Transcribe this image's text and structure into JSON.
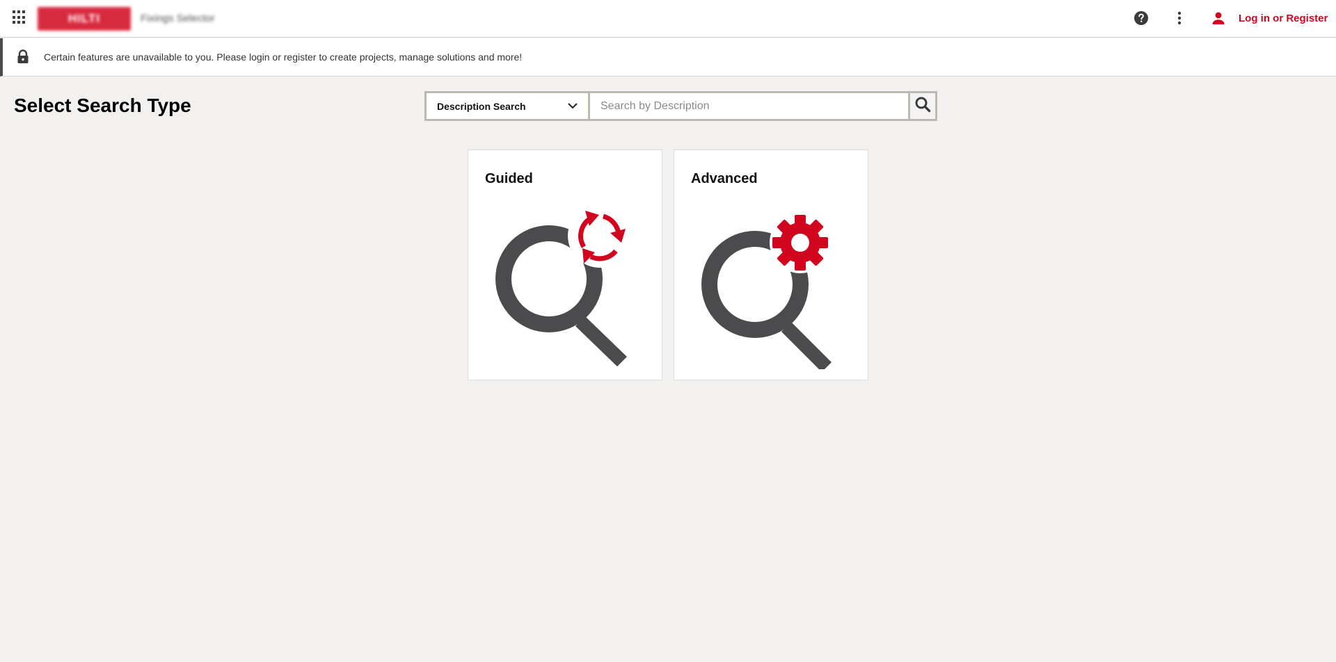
{
  "header": {
    "apps_icon": "apps-grid-icon",
    "brand_logo_text": "HILTI",
    "app_name": "Fixings Selector",
    "help_icon": "help-circle-icon",
    "more_icon": "more-vertical-icon",
    "user_icon": "user-icon",
    "login_label": "Log in or Register"
  },
  "notice": {
    "icon": "lock-icon",
    "message": "Certain features are unavailable to you. Please login or register to create projects, manage solutions and more!"
  },
  "page": {
    "title": "Select Search Type"
  },
  "search": {
    "type_selected": "Description Search",
    "placeholder": "Search by Description",
    "value": "",
    "button_icon": "search-icon"
  },
  "cards": [
    {
      "label": "Guided",
      "icon": "guided-search-icon"
    },
    {
      "label": "Advanced",
      "icon": "advanced-search-icon"
    }
  ],
  "colors": {
    "accent": "#d2051e",
    "icon_gray": "#4b4a4d",
    "background": "#f2f1ef"
  }
}
